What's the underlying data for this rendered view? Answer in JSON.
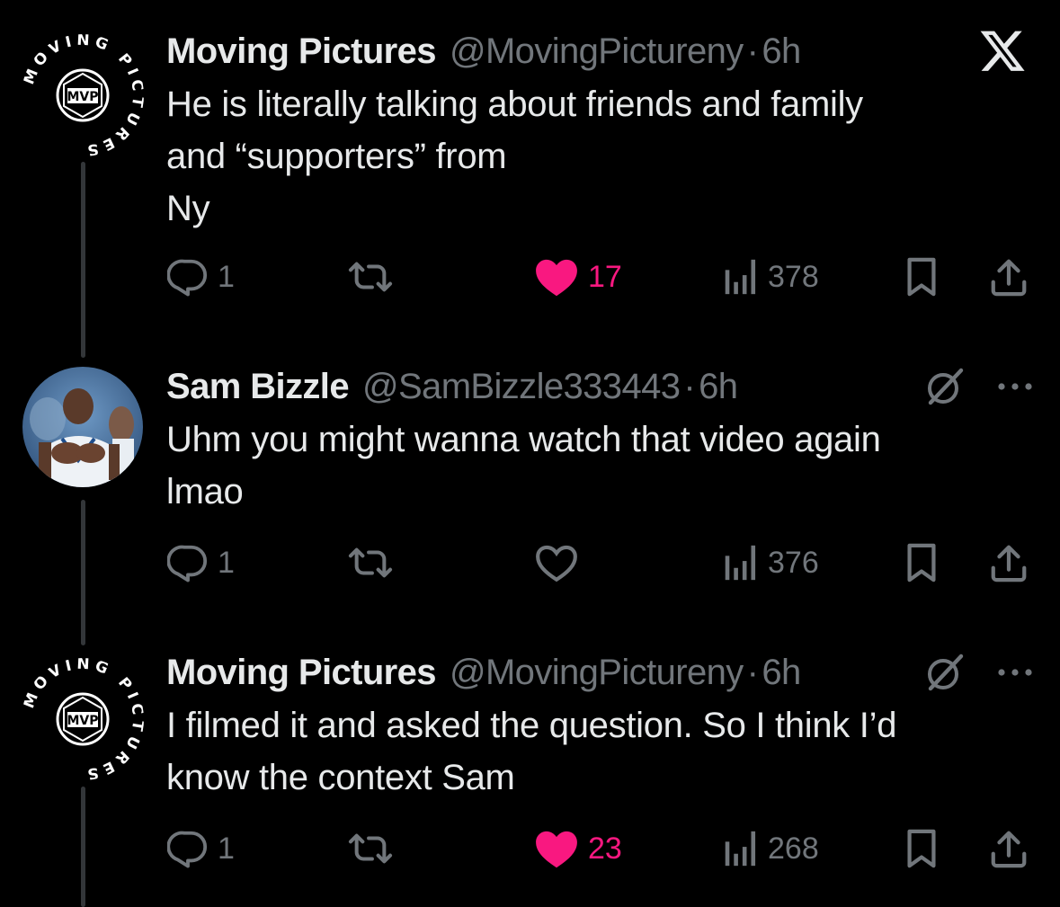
{
  "tweets": [
    {
      "name": "Moving Pictures",
      "handle": "@MovingPictureny",
      "separator": "·",
      "time": "6h",
      "lines": [
        "He is literally talking about friends and family",
        "and “supporters” from",
        "Ny"
      ],
      "replies": "1",
      "likes": "17",
      "liked": true,
      "views": "378",
      "avatar_logo_text": "MVP",
      "avatar_ring_text": "MOVING PICTURES"
    },
    {
      "name": "Sam Bizzle",
      "handle": "@SamBizzle333443",
      "separator": "·",
      "time": "6h",
      "lines": [
        "Uhm you might wanna watch that video again",
        "lmao"
      ],
      "replies": "1",
      "likes": "",
      "liked": false,
      "views": "376"
    },
    {
      "name": "Moving Pictures",
      "handle": "@MovingPictureny",
      "separator": "·",
      "time": "6h",
      "lines": [
        "I filmed it and asked the question. So I think I’d",
        "know the context Sam"
      ],
      "replies": "1",
      "likes": "23",
      "liked": true,
      "views": "268",
      "avatar_logo_text": "MVP",
      "avatar_ring_text": "MOVING PICTURES"
    }
  ],
  "icons": {
    "x_logo": "x-logo-icon",
    "reply": "reply-icon",
    "retweet": "retweet-icon",
    "like": "heart-icon",
    "views": "views-icon",
    "bookmark": "bookmark-icon",
    "share": "share-icon",
    "grok": "grok-icon",
    "more": "more-icon"
  },
  "colors": {
    "background": "#000000",
    "text": "#e7e9ea",
    "secondary": "#71767b",
    "like": "#f91880",
    "thread_line": "#333639"
  }
}
